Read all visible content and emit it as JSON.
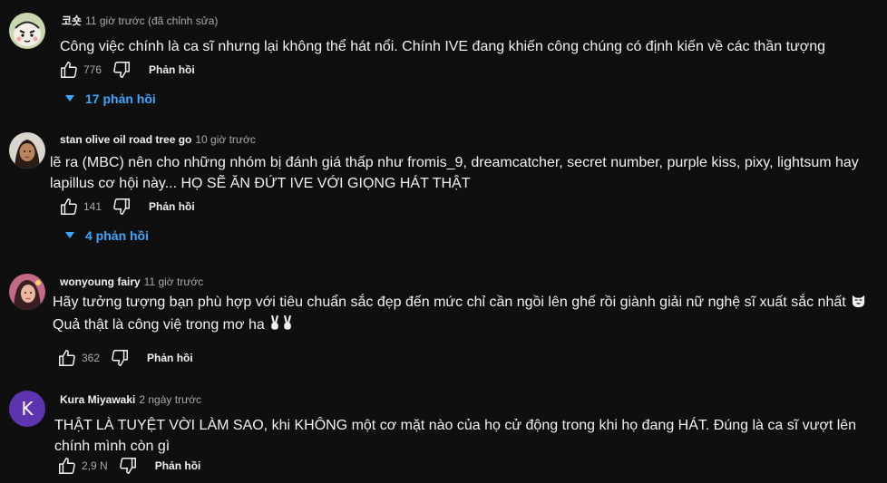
{
  "colors": {
    "background": "#0f0f0f",
    "text_primary": "#f1f1f1",
    "text_secondary": "#aaaaaa",
    "link": "#3ea6ff",
    "avatar_k": "#5e35b1"
  },
  "icons": {
    "like": "thumb-up-icon",
    "dislike": "thumb-down-icon",
    "expand": "caret-down-icon"
  },
  "comments": [
    {
      "author": "코숏",
      "time": "11 giờ trước (đã chỉnh sửa)",
      "body": "Công việc chính là ca sĩ nhưng lại không thể hát nổi. Chính IVE đang khiến công chúng có định kiến về các thần tượng",
      "likes": "776",
      "reply_label": "Phản hồi",
      "replies_label": "17 phản hồi"
    },
    {
      "author": "stan olive oil road tree go",
      "time": "10 giờ trước",
      "body": "lẽ ra (MBC) nên cho những nhóm bị đánh giá thấp như fromis_9, dreamcatcher, secret number, purple kiss, pixy, lightsum hay lapillus cơ hội này... HỌ SẼ ĂN ĐỨT IVE VỚI GIỌNG HÁT THẬT",
      "likes": "141",
      "reply_label": "Phản hồi",
      "replies_label": "4 phản hồi"
    },
    {
      "author": "wonyoung fairy",
      "time": "11 giờ trước",
      "body_a": "Hãy tưởng tượng bạn phù hợp với tiêu chuẩn sắc đẹp đến mức chỉ cần ngồi lên ghế rồi giành giải nữ nghệ sĩ xuất sắc nhất",
      "body_b": "Quả thật là công việ trong mơ ha",
      "likes": "362",
      "reply_label": "Phản hồi"
    },
    {
      "author": "Kura Miyawaki",
      "time": "2 ngày trước",
      "avatar_letter": "K",
      "body": "THẬT LÀ TUYỆT VỜI LÀM SAO, khi KHÔNG một cơ mặt nào của họ cử động trong khi họ đang HÁT. Đúng là ca sĩ vượt lên chính mình còn gì",
      "likes": "2,9 N",
      "reply_label": "Phản hồi"
    }
  ]
}
